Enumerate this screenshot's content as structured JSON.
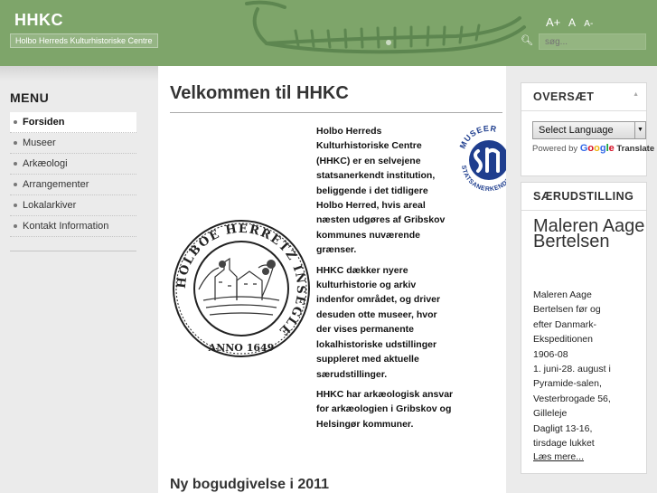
{
  "header": {
    "title": "HHKC",
    "subtitle": "Holbo Herreds Kulturhistoriske Centre",
    "font_size_controls": [
      "A+",
      "A",
      "A-"
    ],
    "search_placeholder": "søg...",
    "search_icon": "search-icon"
  },
  "sidebar": {
    "menu_title": "MENU",
    "items": [
      {
        "label": "Forsiden",
        "active": true
      },
      {
        "label": "Museer",
        "active": false
      },
      {
        "label": "Arkæologi",
        "active": false
      },
      {
        "label": "Arrangementer",
        "active": false
      },
      {
        "label": "Lokalarkiver",
        "active": false
      },
      {
        "label": "Kontakt Information",
        "active": false
      }
    ]
  },
  "main": {
    "title": "Velkommen til HHKC",
    "paragraphs": [
      "Holbo Herreds Kulturhistoriske Centre (HHKC) er en selvejene statsanerkendt institution, beliggende i det tidligere Holbo Herred, hvis areal næsten udgøres af Gribskov kommunes nuværende grænser.",
      "HHKC dækker nyere kulturhistorie og arkiv indenfor området, og driver desuden otte museer, hvor der vises permanente lokalhistoriske udstillinger suppleret med aktuelle særudstillinger.",
      "HHKC har arkæologisk ansvar for arkæologien i Gribskov og Helsingør kommuner."
    ],
    "seal": {
      "ring_text": "HOLBOE HERRETZ INSEGLE",
      "year_text": "ANNO 1649"
    },
    "museer_logo": {
      "top_text": "MUSEER",
      "bottom_text": "STATSANERKENDTE"
    },
    "news_title": "Ny bogudgivelse i 2011"
  },
  "rightbar": {
    "translate": {
      "title": "OVERSÆT",
      "select_label": "Select Language",
      "powered_by": "Powered by",
      "google": "Google",
      "translate_word": "Translate"
    },
    "exhibit": {
      "title": "SÆRUDSTILLING",
      "heading": "Maleren Aage Bertelsen",
      "lines": [
        "Maleren Aage",
        "Bertelsen før og",
        "efter Danmark-",
        "Ekspeditionen",
        "1906-08",
        "1. juni-28. august i",
        "Pyramide-salen,",
        "Vesterbrogade 56,",
        "Gilleleje",
        "Dagligt 13-16,",
        "tirsdage lukket"
      ],
      "more": "Læs mere..."
    }
  },
  "colors": {
    "header_green": "#7ea56a",
    "sidebar_gray": "#ebebeb",
    "museer_blue": "#1f3e8e"
  }
}
